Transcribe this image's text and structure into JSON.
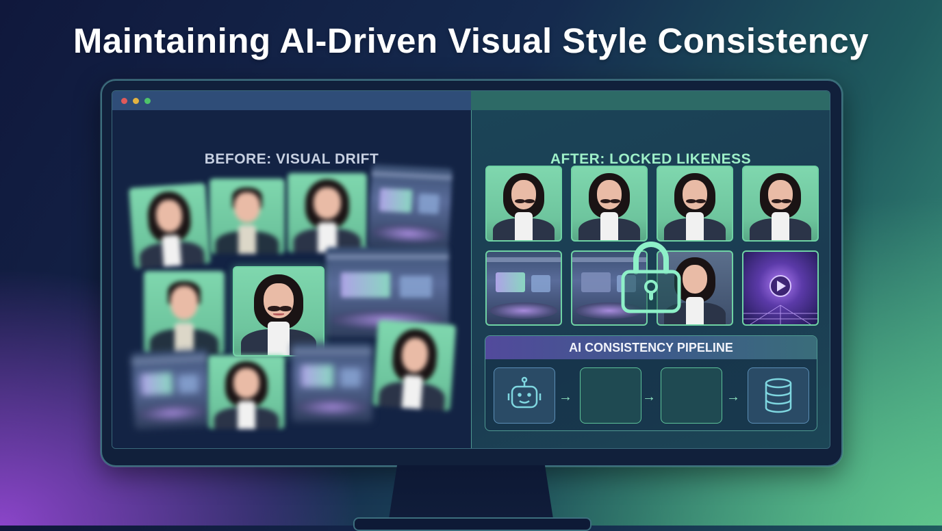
{
  "title": "Maintaining AI-Driven Visual Style Consistency",
  "colors": {
    "accent_green": "#6fd3a4",
    "left_heading": "#c7d0e1",
    "right_heading": "#9ef0c8",
    "window_dot_red": "#e05a5a",
    "window_dot_yellow": "#e3b341",
    "window_dot_green": "#4ec46a"
  },
  "left_pane": {
    "heading": "BEFORE: VISUAL DRIFT",
    "tiles": [
      "portrait-blurred",
      "portrait-male-blurred",
      "portrait-blurred",
      "studio-blurred",
      "portrait-male-blurred",
      "portrait-sharp",
      "studio-blurred",
      "studio-blurred",
      "portrait-blurred",
      "studio-blurred",
      "portrait-blurred"
    ]
  },
  "right_pane": {
    "heading": "AFTER: LOCKED LIKENESS",
    "portrait_row": [
      "portrait",
      "portrait",
      "portrait",
      "portrait"
    ],
    "scene_row": [
      "studio",
      "studio-with-portrait",
      "portrait",
      "video-tunnel"
    ],
    "lock_icon": "padlock-icon"
  },
  "pipeline": {
    "title": "AI CONSISTENCY PIPELINE",
    "steps": [
      {
        "icon": "robot-icon"
      },
      {
        "icon": ""
      },
      {
        "icon": ""
      },
      {
        "icon": "database-icon"
      }
    ],
    "arrow": "→"
  }
}
